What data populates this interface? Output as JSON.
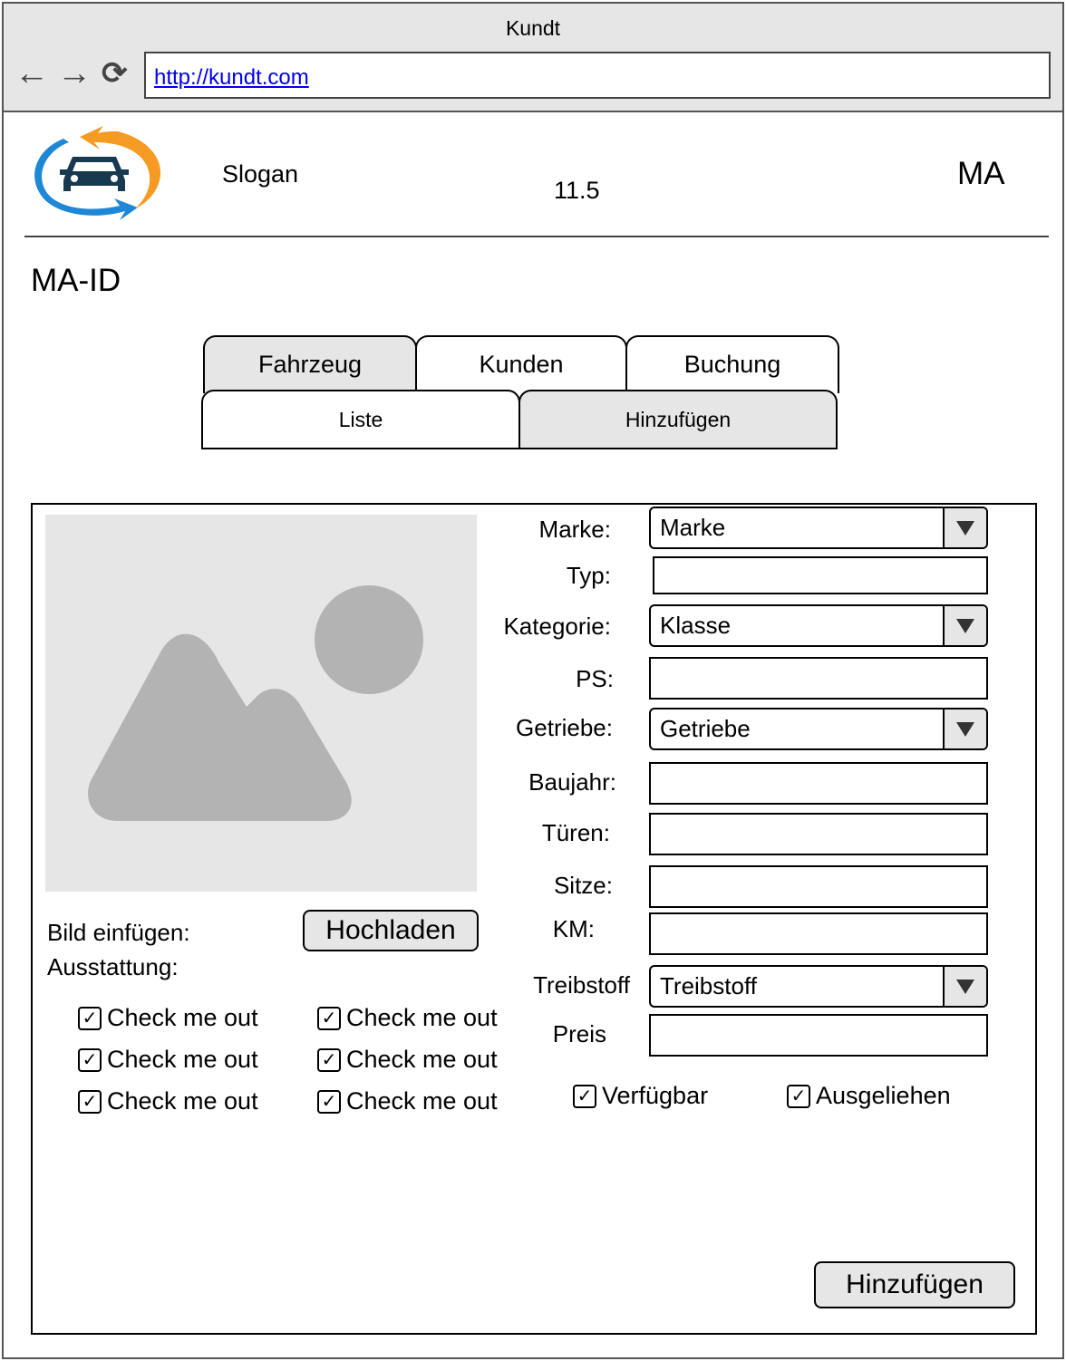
{
  "browser": {
    "title": "Kundt",
    "url": "http://kundt.com",
    "back_icon": "←",
    "forward_icon": "→",
    "reload_icon": "⟳"
  },
  "header": {
    "slogan": "Slogan",
    "version": "11.5",
    "user_role": "MA"
  },
  "page": {
    "id_label": "MA-ID"
  },
  "tabs": [
    {
      "label": "Fahrzeug",
      "active": true
    },
    {
      "label": "Kunden",
      "active": false
    },
    {
      "label": "Buchung",
      "active": false
    }
  ],
  "subtabs": [
    {
      "label": "Liste",
      "active": false
    },
    {
      "label": "Hinzufügen",
      "active": true
    }
  ],
  "form": {
    "image_label": "Bild einfügen:",
    "upload_button": "Hochladen",
    "equipment_label": "Ausstattung:",
    "equipment": [
      {
        "label": "Check me out",
        "checked": true
      },
      {
        "label": "Check me out",
        "checked": true
      },
      {
        "label": "Check me out",
        "checked": true
      },
      {
        "label": "Check me out",
        "checked": true
      },
      {
        "label": "Check me out",
        "checked": true
      },
      {
        "label": "Check me out",
        "checked": true
      }
    ],
    "fields": {
      "marke": {
        "label": "Marke:",
        "value": "Marke"
      },
      "typ": {
        "label": "Typ:",
        "value": ""
      },
      "kategorie": {
        "label": "Kategorie:",
        "value": "Klasse"
      },
      "ps": {
        "label": "PS:",
        "value": ""
      },
      "getriebe": {
        "label": "Getriebe:",
        "value": "Getriebe"
      },
      "baujahr": {
        "label": "Baujahr:",
        "value": ""
      },
      "tueren": {
        "label": "Türen:",
        "value": ""
      },
      "sitze": {
        "label": "Sitze:",
        "value": ""
      },
      "km": {
        "label": "KM:",
        "value": ""
      },
      "treibstoff": {
        "label": "Treibstoff",
        "value": "Treibstoff"
      },
      "preis": {
        "label": "Preis",
        "value": ""
      }
    },
    "status": [
      {
        "label": "Verfügbar",
        "checked": true
      },
      {
        "label": "Ausgeliehen",
        "checked": true
      }
    ],
    "submit_button": "Hinzufügen",
    "check_mark": "✓"
  },
  "colors": {
    "logo_blue": "#1e88d6",
    "logo_orange": "#f59a23",
    "logo_car": "#173a50",
    "chrome_gray": "#e6e6e6",
    "placeholder_gray": "#b3b3b3"
  }
}
